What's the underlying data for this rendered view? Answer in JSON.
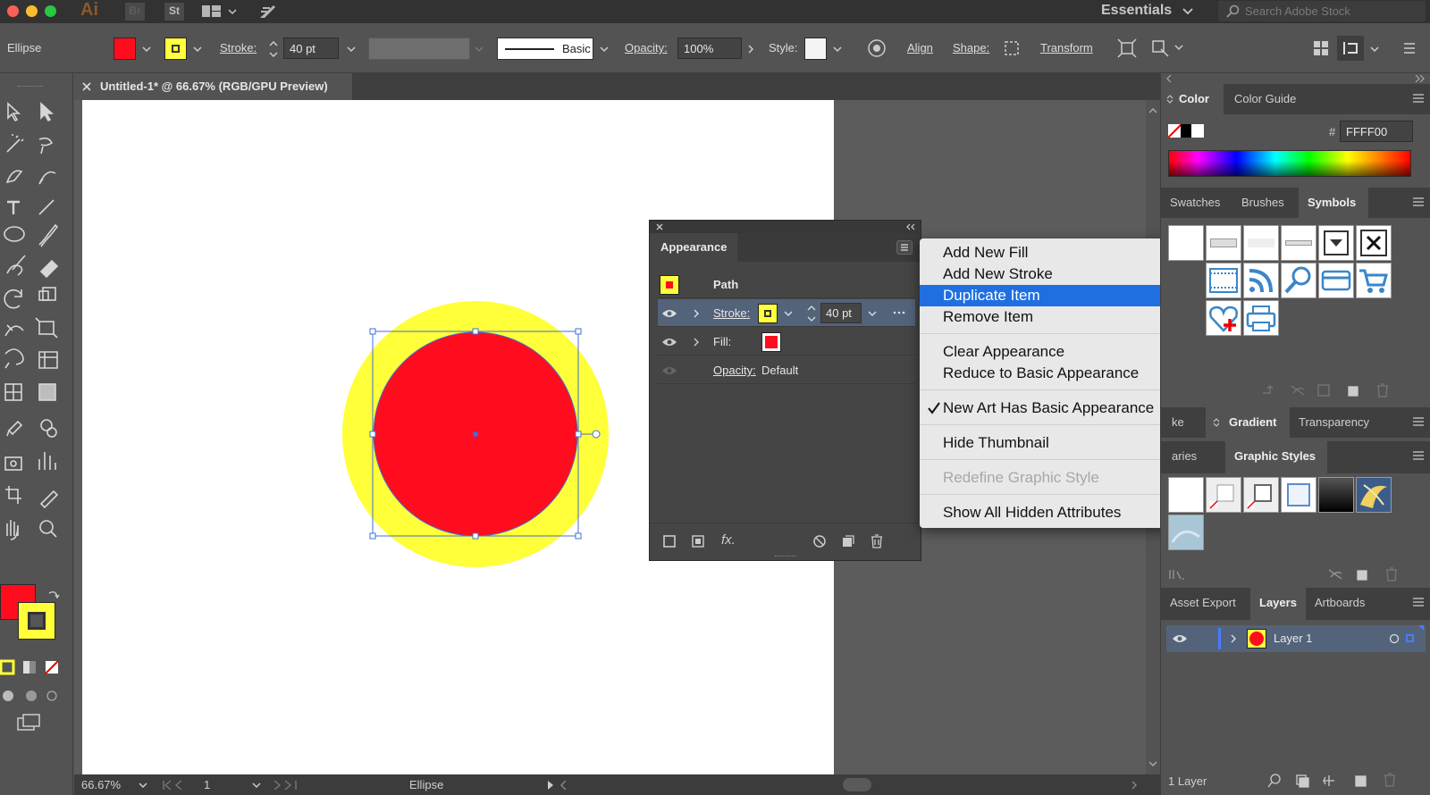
{
  "appbar": {
    "app_icons": [
      "Ai",
      "Br",
      "St"
    ],
    "workspace": "Essentials",
    "search_placeholder": "Search Adobe Stock"
  },
  "control": {
    "object_type": "Ellipse",
    "stroke_label": "Stroke:",
    "stroke_weight": "40 pt",
    "brush_label": "Basic",
    "opacity_label": "Opacity:",
    "opacity_value": "100%",
    "style_label": "Style:",
    "align_label": "Align",
    "shape_label": "Shape:",
    "transform_label": "Transform"
  },
  "document": {
    "tab_title": "Untitled-1* @ 66.67% (RGB/GPU Preview)"
  },
  "status": {
    "zoom": "66.67%",
    "artboard": "1",
    "tool": "Ellipse"
  },
  "appearance": {
    "title": "Appearance",
    "target": "Path",
    "stroke_label": "Stroke:",
    "stroke_weight": "40 pt",
    "fill_label": "Fill:",
    "opacity_label": "Opacity:",
    "opacity_value": "Default",
    "fx_label": "fx."
  },
  "context_menu": {
    "items": [
      {
        "label": "Add New Fill"
      },
      {
        "label": "Add New Stroke"
      },
      {
        "label": "Duplicate Item",
        "selected": true
      },
      {
        "label": "Remove Item"
      },
      {
        "label": "Clear Appearance"
      },
      {
        "label": "Reduce to Basic Appearance"
      },
      {
        "label": "New Art Has Basic Appearance",
        "checked": true
      },
      {
        "label": "Hide Thumbnail"
      },
      {
        "label": "Redefine Graphic Style",
        "disabled": true
      },
      {
        "label": "Show All Hidden Attributes"
      }
    ]
  },
  "color_panel": {
    "tabs": [
      "Color",
      "Color Guide"
    ],
    "hex_label": "#",
    "hex_value": "FFFF00"
  },
  "symbols_panel": {
    "tabs": [
      "Swatches",
      "Brushes",
      "Symbols"
    ]
  },
  "gradient_panel": {
    "tabs": [
      "ke",
      "Gradient",
      "Transparency"
    ]
  },
  "graphic_styles_panel": {
    "tabs": [
      "aries",
      "Graphic Styles"
    ]
  },
  "layers_panel": {
    "tabs": [
      "Asset Export",
      "Layers",
      "Artboards"
    ],
    "layer_name": "Layer 1",
    "count_label": "1 Layer"
  },
  "colors": {
    "fill": "#ff0d1e",
    "stroke": "#ffff3a",
    "selection": "#3f6fd9",
    "menu_highlight": "#1f6fe0"
  }
}
